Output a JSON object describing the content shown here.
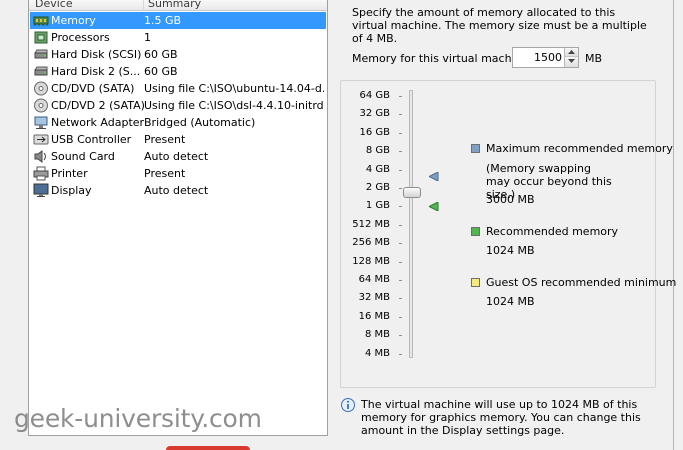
{
  "device_list": {
    "headers": {
      "device": "Device",
      "summary": "Summary"
    },
    "rows": [
      {
        "label": "Memory",
        "summary": "1.5 GB",
        "icon": "memory-icon",
        "selected": true
      },
      {
        "label": "Processors",
        "summary": "1",
        "icon": "processor-icon"
      },
      {
        "label": "Hard Disk (SCSI)",
        "summary": "60 GB",
        "icon": "hard-disk-icon"
      },
      {
        "label": "Hard Disk 2 (S...",
        "summary": "60 GB",
        "icon": "hard-disk-icon"
      },
      {
        "label": "CD/DVD (SATA)",
        "summary": "Using file C:\\ISO\\ubuntu-14.04-d...",
        "icon": "cd-dvd-icon"
      },
      {
        "label": "CD/DVD 2 (SATA)",
        "summary": "Using file C:\\ISO\\dsl-4.4.10-initrd....",
        "icon": "cd-dvd-icon"
      },
      {
        "label": "Network Adapter",
        "summary": "Bridged (Automatic)",
        "icon": "network-adapter-icon"
      },
      {
        "label": "USB Controller",
        "summary": "Present",
        "icon": "usb-icon"
      },
      {
        "label": "Sound Card",
        "summary": "Auto detect",
        "icon": "sound-card-icon"
      },
      {
        "label": "Printer",
        "summary": "Present",
        "icon": "printer-icon"
      },
      {
        "label": "Display",
        "summary": "Auto detect",
        "icon": "display-icon"
      }
    ]
  },
  "memory": {
    "description": "Specify the amount of memory allocated to this virtual machine. The memory size must be a multiple of 4 MB.",
    "label": "Memory for this virtual machine:",
    "value": "1500",
    "unit": "MB",
    "slider_ticks": [
      "64 GB",
      "32 GB",
      "16 GB",
      "8 GB",
      "4 GB",
      "2 GB",
      "1 GB",
      "512 MB",
      "256 MB",
      "128 MB",
      "64 MB",
      "32 MB",
      "16 MB",
      "8 MB",
      "4 MB"
    ],
    "current_value_mb": 1500,
    "legend": {
      "maximum": {
        "title": "Maximum recommended memory",
        "note": "(Memory swapping may occur beyond this size.)",
        "value": "3000 MB",
        "color": "#7f9fc4"
      },
      "recommended": {
        "title": "Recommended memory",
        "value": "1024 MB",
        "color": "#52b552"
      },
      "guest_min": {
        "title": "Guest OS recommended minimum",
        "value": "1024 MB",
        "color": "#f4ec7c"
      }
    },
    "info": "The virtual machine will use up to 1024 MB of this memory for graphics memory. You can change this amount in the Display settings page."
  },
  "watermark": "geek-university.com",
  "colors": {
    "selection": "#3399ff",
    "accent_red": "#d83a2e"
  }
}
